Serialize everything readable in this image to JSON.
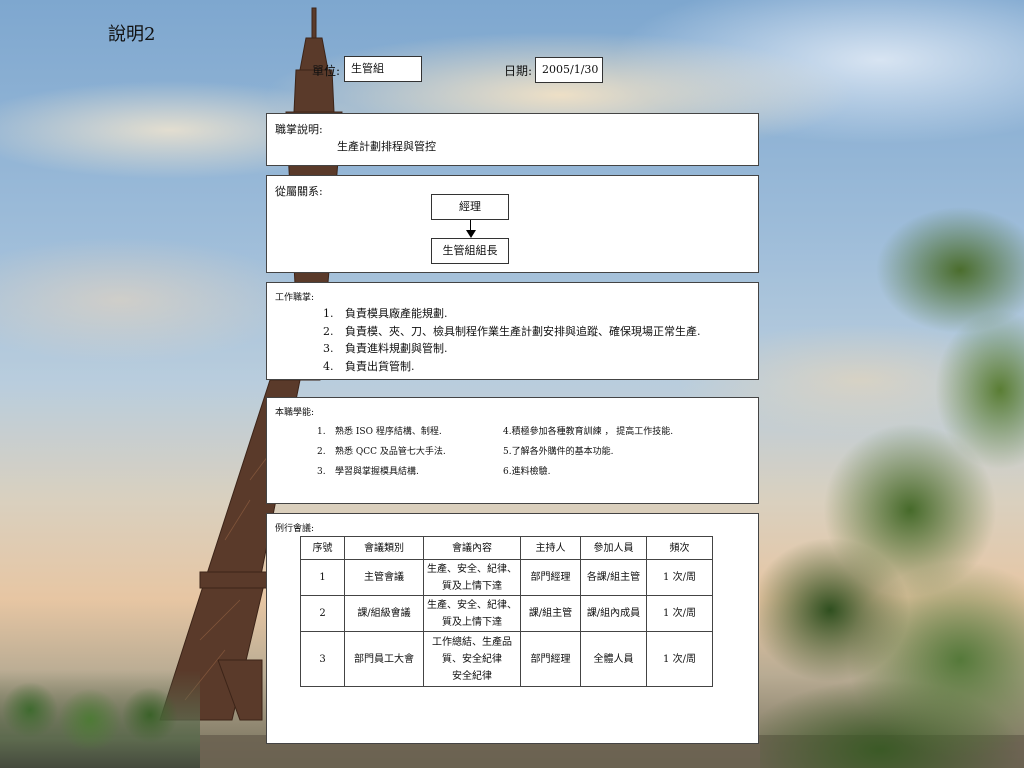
{
  "slide": {
    "title": "說明2"
  },
  "header": {
    "unit_label": "單位:",
    "unit_value": "生管組",
    "date_label": "日期:",
    "date_value": "2005/1/30"
  },
  "duty": {
    "label": "職掌說明:",
    "text": "生產計劃排程與管控"
  },
  "relation": {
    "label": "從屬關系:",
    "top": "經理",
    "bottom": "生管組組長"
  },
  "tasks": {
    "label": "工作職掌:",
    "items": [
      "負責模具廠產能規劃.",
      "負責模、夾、刀、檢具制程作業生產計劃安排與追蹤、確保現場正常生產.",
      "負責進料規劃與管制.",
      "負責出貨管制."
    ]
  },
  "learning": {
    "label": "本職學能:",
    "left": [
      {
        "num": "1.",
        "text": "熟悉 ISO 程序結構、制程."
      },
      {
        "num": "2.",
        "text": "熟悉 QCC 及品管七大手法."
      },
      {
        "num": "3.",
        "text": "學習與掌握模具結構."
      }
    ],
    "right": [
      {
        "text": "4.積極參加各種教育訓練 ， 提高工作技能."
      },
      {
        "text": "5.了解各外購件的基本功能."
      },
      {
        "text": "6.進料檢驗."
      }
    ]
  },
  "meetings": {
    "label": "例行會議:",
    "headers": [
      "序號",
      "會議類別",
      "會議內容",
      "主持人",
      "參加人員",
      "頻次"
    ],
    "rows": [
      {
        "no": "1",
        "type": "主管會議",
        "content": [
          "生產、安全、紀律、",
          "質及上情下達"
        ],
        "host": "部門經理",
        "attendees": "各課/組主管",
        "freq": "1 次/周"
      },
      {
        "no": "2",
        "type": "課/組級會議",
        "content": [
          "生產、安全、紀律、",
          "質及上情下達"
        ],
        "host": "課/組主管",
        "attendees": "課/組內成員",
        "freq": "1 次/周"
      },
      {
        "no": "3",
        "type": "部門員工大會",
        "content": [
          "工作總結、生產品",
          "質、安全紀律",
          "安全紀律"
        ],
        "host": "部門經理",
        "attendees": "全體人員",
        "freq": "1 次/周"
      }
    ]
  }
}
